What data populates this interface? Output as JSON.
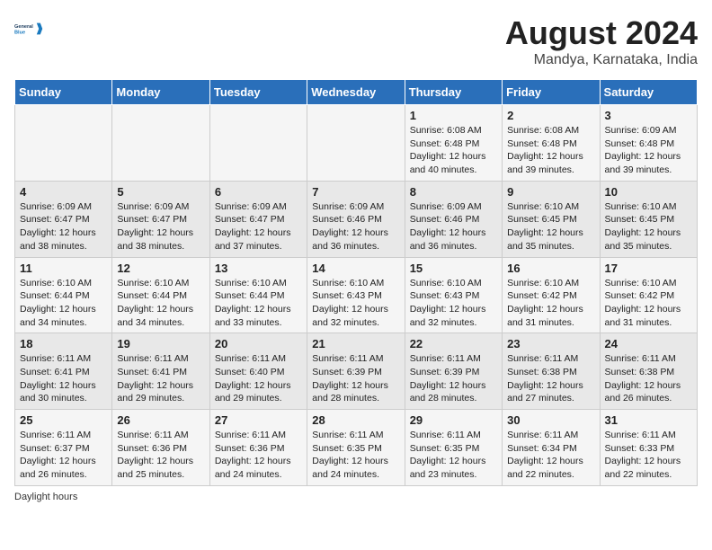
{
  "logo": {
    "line1": "General",
    "line2": "Blue"
  },
  "title": "August 2024",
  "subtitle": "Mandya, Karnataka, India",
  "days_of_week": [
    "Sunday",
    "Monday",
    "Tuesday",
    "Wednesday",
    "Thursday",
    "Friday",
    "Saturday"
  ],
  "weeks": [
    [
      {
        "day": "",
        "info": ""
      },
      {
        "day": "",
        "info": ""
      },
      {
        "day": "",
        "info": ""
      },
      {
        "day": "",
        "info": ""
      },
      {
        "day": "1",
        "info": "Sunrise: 6:08 AM\nSunset: 6:48 PM\nDaylight: 12 hours and 40 minutes."
      },
      {
        "day": "2",
        "info": "Sunrise: 6:08 AM\nSunset: 6:48 PM\nDaylight: 12 hours and 39 minutes."
      },
      {
        "day": "3",
        "info": "Sunrise: 6:09 AM\nSunset: 6:48 PM\nDaylight: 12 hours and 39 minutes."
      }
    ],
    [
      {
        "day": "4",
        "info": "Sunrise: 6:09 AM\nSunset: 6:47 PM\nDaylight: 12 hours and 38 minutes."
      },
      {
        "day": "5",
        "info": "Sunrise: 6:09 AM\nSunset: 6:47 PM\nDaylight: 12 hours and 38 minutes."
      },
      {
        "day": "6",
        "info": "Sunrise: 6:09 AM\nSunset: 6:47 PM\nDaylight: 12 hours and 37 minutes."
      },
      {
        "day": "7",
        "info": "Sunrise: 6:09 AM\nSunset: 6:46 PM\nDaylight: 12 hours and 36 minutes."
      },
      {
        "day": "8",
        "info": "Sunrise: 6:09 AM\nSunset: 6:46 PM\nDaylight: 12 hours and 36 minutes."
      },
      {
        "day": "9",
        "info": "Sunrise: 6:10 AM\nSunset: 6:45 PM\nDaylight: 12 hours and 35 minutes."
      },
      {
        "day": "10",
        "info": "Sunrise: 6:10 AM\nSunset: 6:45 PM\nDaylight: 12 hours and 35 minutes."
      }
    ],
    [
      {
        "day": "11",
        "info": "Sunrise: 6:10 AM\nSunset: 6:44 PM\nDaylight: 12 hours and 34 minutes."
      },
      {
        "day": "12",
        "info": "Sunrise: 6:10 AM\nSunset: 6:44 PM\nDaylight: 12 hours and 34 minutes."
      },
      {
        "day": "13",
        "info": "Sunrise: 6:10 AM\nSunset: 6:44 PM\nDaylight: 12 hours and 33 minutes."
      },
      {
        "day": "14",
        "info": "Sunrise: 6:10 AM\nSunset: 6:43 PM\nDaylight: 12 hours and 32 minutes."
      },
      {
        "day": "15",
        "info": "Sunrise: 6:10 AM\nSunset: 6:43 PM\nDaylight: 12 hours and 32 minutes."
      },
      {
        "day": "16",
        "info": "Sunrise: 6:10 AM\nSunset: 6:42 PM\nDaylight: 12 hours and 31 minutes."
      },
      {
        "day": "17",
        "info": "Sunrise: 6:10 AM\nSunset: 6:42 PM\nDaylight: 12 hours and 31 minutes."
      }
    ],
    [
      {
        "day": "18",
        "info": "Sunrise: 6:11 AM\nSunset: 6:41 PM\nDaylight: 12 hours and 30 minutes."
      },
      {
        "day": "19",
        "info": "Sunrise: 6:11 AM\nSunset: 6:41 PM\nDaylight: 12 hours and 29 minutes."
      },
      {
        "day": "20",
        "info": "Sunrise: 6:11 AM\nSunset: 6:40 PM\nDaylight: 12 hours and 29 minutes."
      },
      {
        "day": "21",
        "info": "Sunrise: 6:11 AM\nSunset: 6:39 PM\nDaylight: 12 hours and 28 minutes."
      },
      {
        "day": "22",
        "info": "Sunrise: 6:11 AM\nSunset: 6:39 PM\nDaylight: 12 hours and 28 minutes."
      },
      {
        "day": "23",
        "info": "Sunrise: 6:11 AM\nSunset: 6:38 PM\nDaylight: 12 hours and 27 minutes."
      },
      {
        "day": "24",
        "info": "Sunrise: 6:11 AM\nSunset: 6:38 PM\nDaylight: 12 hours and 26 minutes."
      }
    ],
    [
      {
        "day": "25",
        "info": "Sunrise: 6:11 AM\nSunset: 6:37 PM\nDaylight: 12 hours and 26 minutes."
      },
      {
        "day": "26",
        "info": "Sunrise: 6:11 AM\nSunset: 6:36 PM\nDaylight: 12 hours and 25 minutes."
      },
      {
        "day": "27",
        "info": "Sunrise: 6:11 AM\nSunset: 6:36 PM\nDaylight: 12 hours and 24 minutes."
      },
      {
        "day": "28",
        "info": "Sunrise: 6:11 AM\nSunset: 6:35 PM\nDaylight: 12 hours and 24 minutes."
      },
      {
        "day": "29",
        "info": "Sunrise: 6:11 AM\nSunset: 6:35 PM\nDaylight: 12 hours and 23 minutes."
      },
      {
        "day": "30",
        "info": "Sunrise: 6:11 AM\nSunset: 6:34 PM\nDaylight: 12 hours and 22 minutes."
      },
      {
        "day": "31",
        "info": "Sunrise: 6:11 AM\nSunset: 6:33 PM\nDaylight: 12 hours and 22 minutes."
      }
    ]
  ],
  "footer": "Daylight hours"
}
